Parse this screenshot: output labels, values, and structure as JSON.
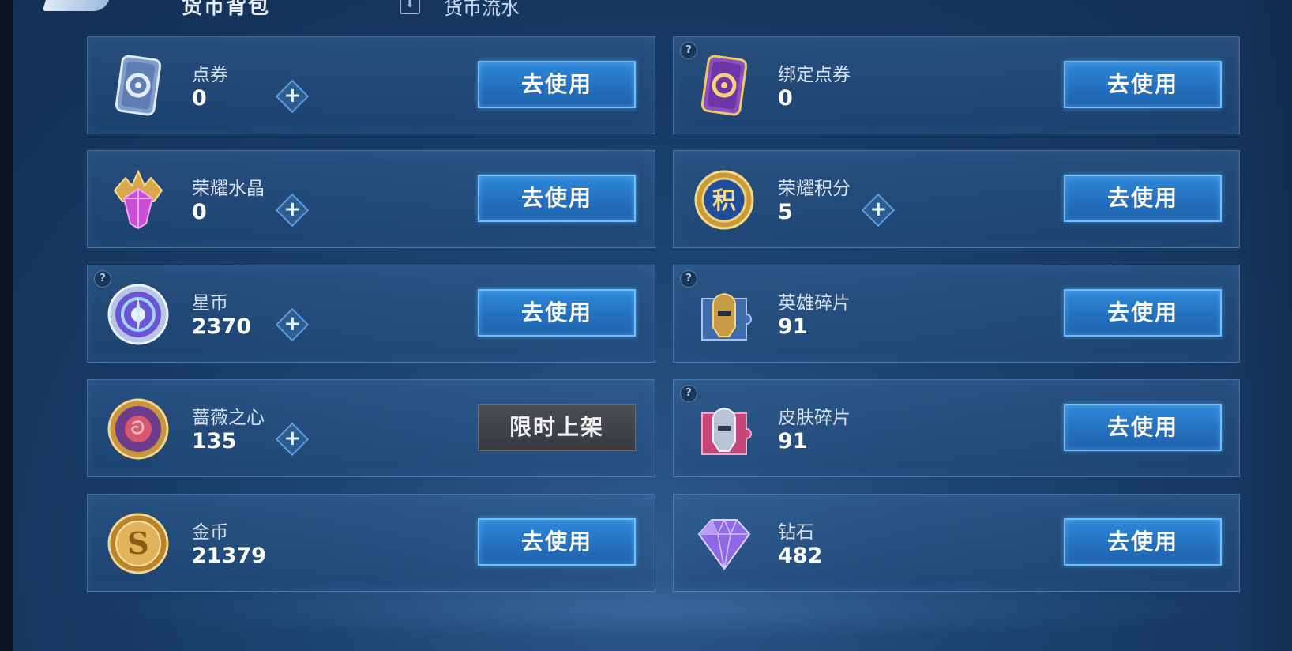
{
  "header": {
    "title": "货币背包",
    "flow_label": "货币流水"
  },
  "cards": [
    {
      "name": "点券",
      "amount": "0",
      "button": "去使用",
      "icon": "voucher-card-icon"
    },
    {
      "name": "绑定点券",
      "amount": "0",
      "button": "去使用",
      "icon": "bound-voucher-card-icon"
    },
    {
      "name": "荣耀水晶",
      "amount": "0",
      "button": "去使用",
      "icon": "glory-crystal-icon"
    },
    {
      "name": "荣耀积分",
      "amount": "5",
      "button": "去使用",
      "icon": "glory-points-icon",
      "icon_text": "积"
    },
    {
      "name": "星币",
      "amount": "2370",
      "button": "去使用",
      "icon": "star-coin-icon"
    },
    {
      "name": "英雄碎片",
      "amount": "91",
      "button": "去使用",
      "icon": "hero-fragment-icon"
    },
    {
      "name": "蔷薇之心",
      "amount": "135",
      "button": "限时上架",
      "icon": "rose-heart-icon"
    },
    {
      "name": "皮肤碎片",
      "amount": "91",
      "button": "去使用",
      "icon": "skin-fragment-icon"
    },
    {
      "name": "金币",
      "amount": "21379",
      "button": "去使用",
      "icon": "gold-coin-icon",
      "icon_text": "S"
    },
    {
      "name": "钻石",
      "amount": "482",
      "button": "去使用",
      "icon": "diamond-icon"
    }
  ],
  "ui": {
    "plus_symbol": "+",
    "help_symbol": "?"
  },
  "colors": {
    "background": "#1d4573",
    "card": "#2a5a92",
    "button": "#2471bf",
    "button_border": "#6cc0ff",
    "limited_button": "#3a3e43"
  }
}
